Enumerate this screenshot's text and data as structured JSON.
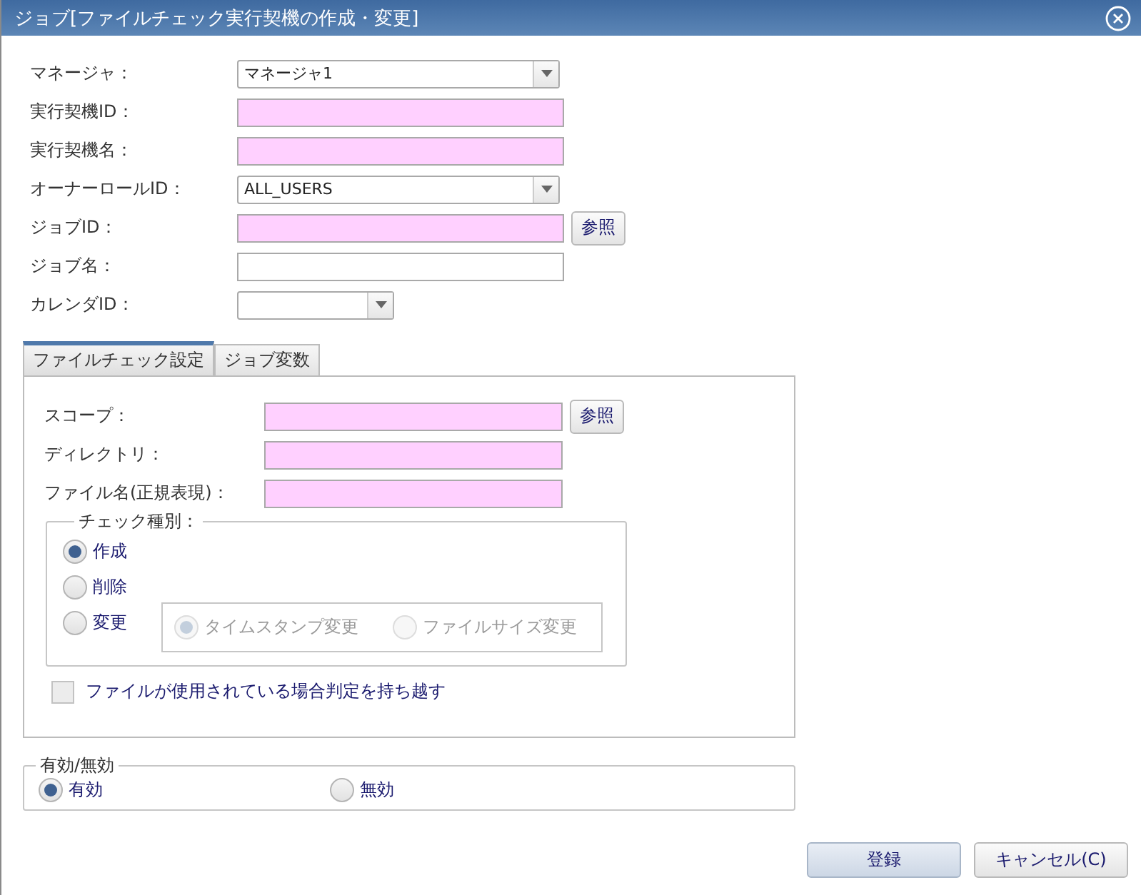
{
  "window": {
    "title": "ジョブ[ファイルチェック実行契機の作成・変更]"
  },
  "fields": [
    {
      "label": "マネージャ：",
      "kind": "select",
      "value": "マネージャ1",
      "required": false
    },
    {
      "label": "実行契機ID：",
      "kind": "input",
      "required": true
    },
    {
      "label": "実行契機名：",
      "kind": "input",
      "required": true
    },
    {
      "label": "オーナーロールID：",
      "kind": "select",
      "value": "ALL_USERS",
      "required": false
    },
    {
      "label": "ジョブID：",
      "kind": "input",
      "required": true,
      "button": "参照"
    },
    {
      "label": "ジョブ名：",
      "kind": "input",
      "required": false
    },
    {
      "label": "カレンダID：",
      "kind": "short_select",
      "required": false
    }
  ],
  "tabs": [
    {
      "label": "ファイルチェック設定",
      "selected": true
    },
    {
      "label": "ジョブ変数",
      "selected": false
    }
  ],
  "file_check": {
    "fields": [
      {
        "label": "スコープ：",
        "kind": "input",
        "required": true,
        "button": "参照"
      },
      {
        "label": "ディレクトリ：",
        "kind": "input",
        "required": true
      },
      {
        "label": "ファイル名(正規表現)：",
        "kind": "input",
        "required": true
      }
    ],
    "check_type": {
      "legend": "チェック種別：",
      "options": [
        {
          "label": "作成",
          "selected": true
        },
        {
          "label": "削除",
          "selected": false
        },
        {
          "label": "変更",
          "selected": false
        }
      ],
      "modify_options": [
        {
          "label": "タイムスタンプ変更",
          "selected": true,
          "disabled": true
        },
        {
          "label": "ファイルサイズ変更",
          "selected": false,
          "disabled": true
        }
      ]
    },
    "carry_over": {
      "label": "ファイルが使用されている場合判定を持ち越す",
      "checked": false
    }
  },
  "validity": {
    "legend": "有効/無効",
    "options": [
      {
        "label": "有効",
        "selected": true
      },
      {
        "label": "無効",
        "selected": false
      }
    ]
  },
  "buttons": [
    {
      "label": "登録",
      "kind": "primary"
    },
    {
      "label": "キャンセル(C)",
      "kind": "default"
    }
  ]
}
